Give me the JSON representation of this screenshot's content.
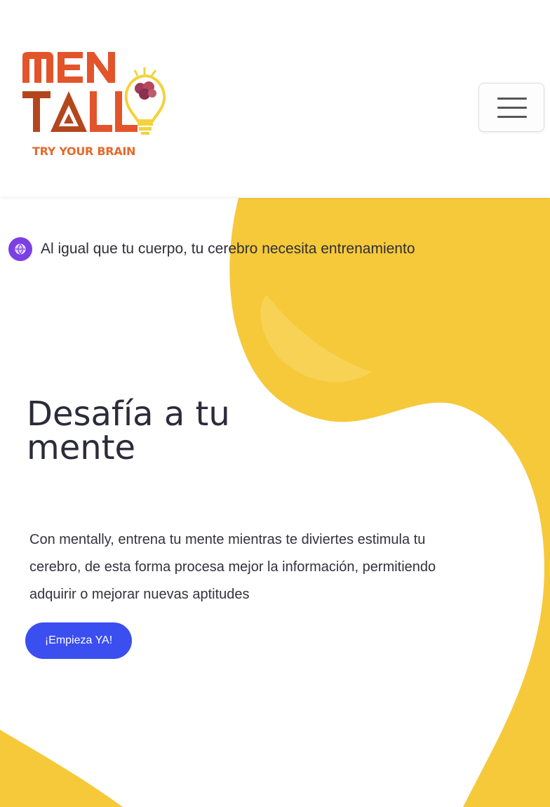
{
  "header": {
    "logo": {
      "line1": "MEN",
      "line2": "TALL",
      "tagline": "TRY YOUR BRAIN",
      "primary_color": "#e3542b",
      "secondary_color": "#b4461e",
      "accent_color": "#f4d23c",
      "brain_color": "#9c3a5a"
    },
    "menu_icon": "hamburger-icon"
  },
  "hero": {
    "announcement": {
      "icon": "globe-icon",
      "icon_color": "#7b3fe4",
      "text": "Al igual que tu cuerpo, tu cerebro necesita entrenamiento"
    },
    "title": "Desafía a tu mente",
    "description": "Con mentally, entrena tu mente mientras te diviertes estimula tu cerebro, de esta forma procesa mejor la información, permitiendo adquirir o mejorar nuevas aptitudes",
    "cta_label": "¡Empieza YA!",
    "cta_color": "#3b4ef0",
    "blob_color": "#f6c93a"
  }
}
